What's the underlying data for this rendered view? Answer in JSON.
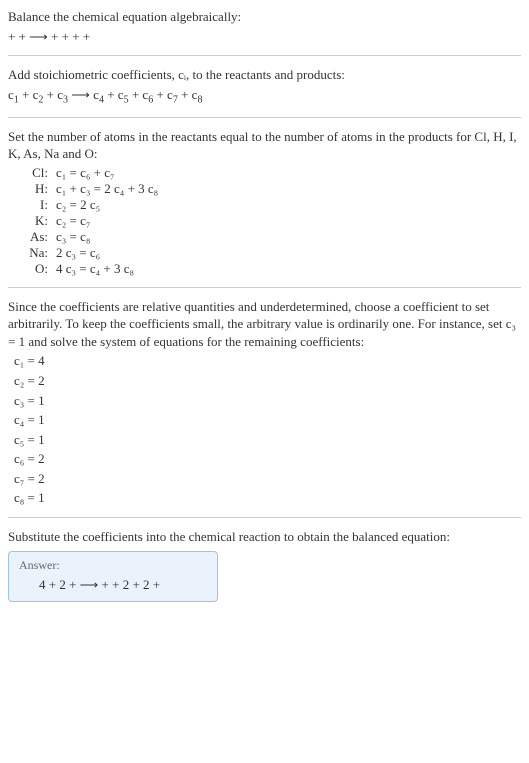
{
  "intro": {
    "l1": "Balance the chemical equation algebraically:",
    "l2": " +  +  ⟶  +  +  +  + "
  },
  "step1": {
    "l1": "Add stoichiometric coefficients, cᵢ, to the reactants and products:",
    "eq_parts": {
      "c1": "c",
      "s1": "1",
      "p1": "  + ",
      "c2": "c",
      "s2": "2",
      "p2": "  + ",
      "c3": "c",
      "s3": "3",
      "p3": "   ⟶ ",
      "c4": "c",
      "s4": "4",
      "p4": "  + ",
      "c5": "c",
      "s5": "5",
      "p5": "  + ",
      "c6": "c",
      "s6": "6",
      "p6": "  + ",
      "c7": "c",
      "s7": "7",
      "p7": "  + ",
      "c8": "c",
      "s8": "8"
    }
  },
  "step2": {
    "l1": "Set the number of atoms in the reactants equal to the number of atoms in the products for Cl, H, I, K, As, Na and O:",
    "rows": [
      {
        "label": "Cl:",
        "eq": "c₁ = c₆ + c₇"
      },
      {
        "label": "H:",
        "eq": "c₁ + c₃ = 2 c₄ + 3 c₈"
      },
      {
        "label": "I:",
        "eq": "c₂ = 2 c₅"
      },
      {
        "label": "K:",
        "eq": "c₂ = c₇"
      },
      {
        "label": "As:",
        "eq": "c₃ = c₈"
      },
      {
        "label": "Na:",
        "eq": "2 c₃ = c₆"
      },
      {
        "label": "O:",
        "eq": "4 c₃ = c₄ + 3 c₈"
      }
    ]
  },
  "step3": {
    "l1": "Since the coefficients are relative quantities and underdetermined, choose a coefficient to set arbitrarily. To keep the coefficients small, the arbitrary value is ordinarily one. For instance, set c₃ = 1 and solve the system of equations for the remaining coefficients:",
    "sol": [
      "c₁ = 4",
      "c₂ = 2",
      "c₃ = 1",
      "c₄ = 1",
      "c₅ = 1",
      "c₆ = 2",
      "c₇ = 2",
      "c₈ = 1"
    ]
  },
  "step4": {
    "l1": "Substitute the coefficients into the chemical reaction to obtain the balanced equation:"
  },
  "answer": {
    "label": "Answer:",
    "eq": "4  + 2  +  ⟶  +  + 2  + 2  + "
  },
  "chart_data": {
    "type": "table",
    "title": "Atom balance equations and solved stoichiometric coefficients",
    "balance_equations": [
      {
        "element": "Cl",
        "equation": "c1 = c6 + c7"
      },
      {
        "element": "H",
        "equation": "c1 + c3 = 2 c4 + 3 c8"
      },
      {
        "element": "I",
        "equation": "c2 = 2 c5"
      },
      {
        "element": "K",
        "equation": "c2 = c7"
      },
      {
        "element": "As",
        "equation": "c3 = c8"
      },
      {
        "element": "Na",
        "equation": "2 c3 = c6"
      },
      {
        "element": "O",
        "equation": "4 c3 = c4 + 3 c8"
      }
    ],
    "coefficients": {
      "c1": 4,
      "c2": 2,
      "c3": 1,
      "c4": 1,
      "c5": 1,
      "c6": 2,
      "c7": 2,
      "c8": 1
    }
  }
}
